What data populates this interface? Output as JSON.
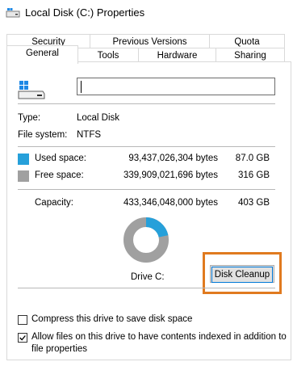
{
  "window": {
    "title": "Local Disk (C:) Properties",
    "icon": "drive-icon"
  },
  "tabs_back": [
    {
      "label": "Security"
    },
    {
      "label": "Previous Versions"
    },
    {
      "label": "Quota"
    }
  ],
  "tabs_front": [
    {
      "label": "General",
      "active": true
    },
    {
      "label": "Tools"
    },
    {
      "label": "Hardware"
    },
    {
      "label": "Sharing"
    }
  ],
  "general": {
    "volume_label_value": "",
    "type_label": "Type:",
    "type_value": "Local Disk",
    "fs_label": "File system:",
    "fs_value": "NTFS",
    "used_label": "Used space:",
    "used_bytes": "93,437,026,304 bytes",
    "used_gb": "87.0 GB",
    "free_label": "Free space:",
    "free_bytes": "339,909,021,696 bytes",
    "free_gb": "316 GB",
    "capacity_label": "Capacity:",
    "capacity_bytes": "433,346,048,000 bytes",
    "capacity_gb": "403 GB",
    "drive_label": "Drive C:",
    "used_fraction": 0.216,
    "colors": {
      "used": "#26a0da",
      "free": "#a0a0a0",
      "highlight": "#e07a1f"
    },
    "cleanup_label": "Disk Cleanup",
    "compress_label": "Compress this drive to save disk space",
    "compress_checked": false,
    "index_label_line1": "Allow files on this drive to have contents indexed in addition to",
    "index_label_line2": "file properties",
    "index_checked": true
  }
}
